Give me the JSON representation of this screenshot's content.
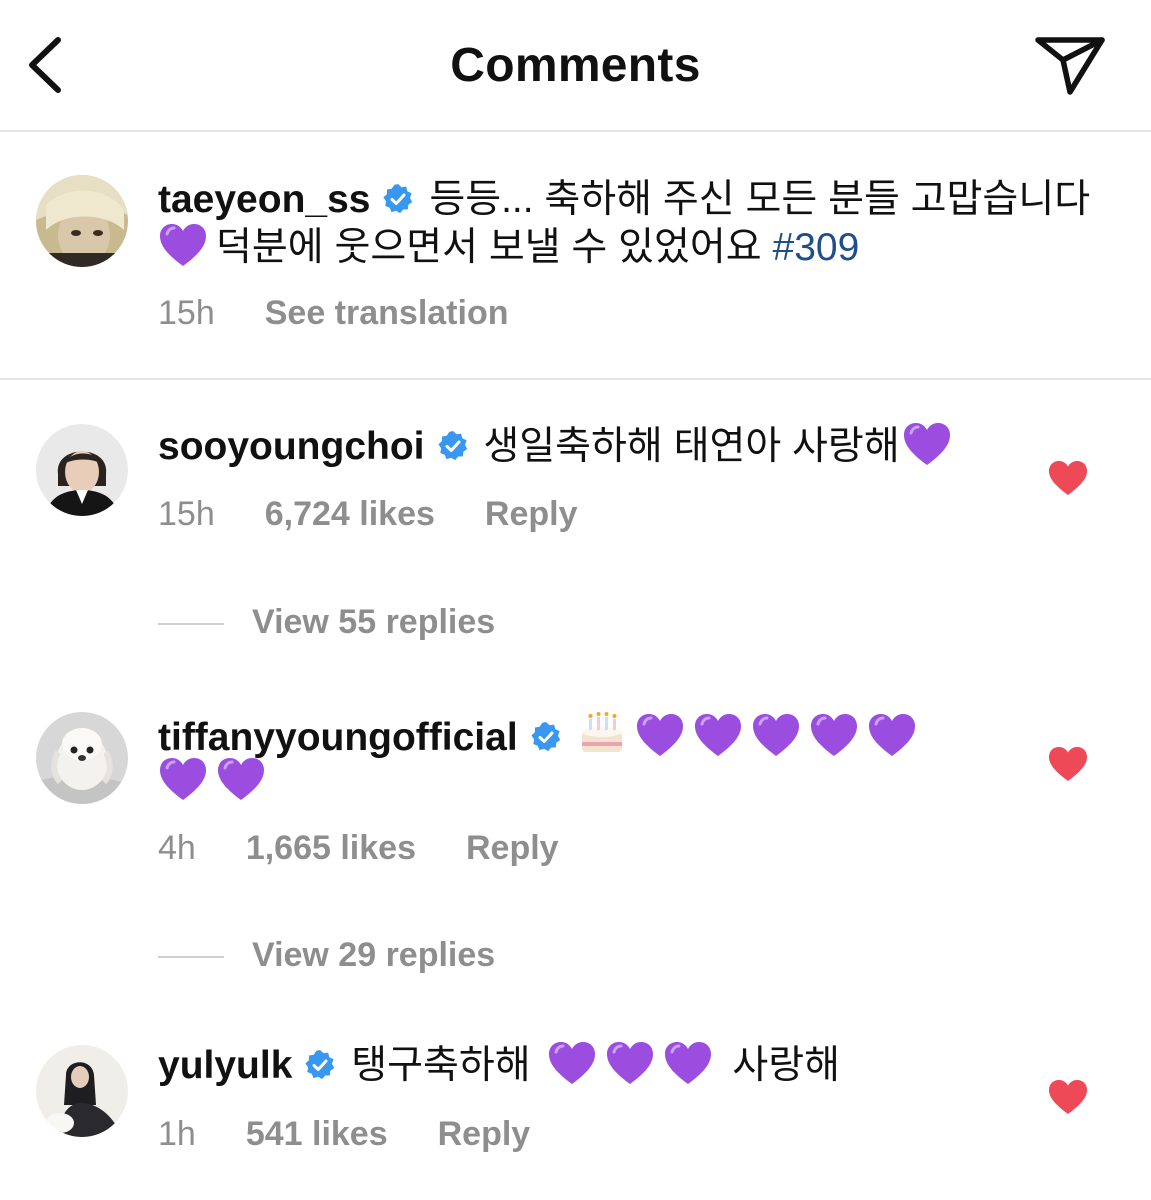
{
  "header": {
    "title": "Comments"
  },
  "caption": {
    "username": "taeyeon_ss",
    "text_part1": "등등... 축하해 주신 모든 분들 고맙습니다",
    "text_part2": "덕분에 웃으면서 보낼 수 있었어요",
    "hashtag": "#309",
    "time": "15h",
    "see_translation": "See translation"
  },
  "comments": [
    {
      "username": "sooyoungchoi",
      "text": "생일축하해 태연아 사랑해",
      "time": "15h",
      "likes": "6,724 likes",
      "reply": "Reply",
      "view_replies": "View 55 replies"
    },
    {
      "username": "tiffanyyoungofficial",
      "time": "4h",
      "likes": "1,665 likes",
      "reply": "Reply",
      "view_replies": "View 29 replies"
    },
    {
      "username": "yulyulk",
      "text_part1": "탱구축하해",
      "text_part2": "사랑해",
      "time": "1h",
      "likes": "541 likes",
      "reply": "Reply"
    }
  ],
  "colors": {
    "verified": "#3897f0",
    "purple_heart": "#9b4de0",
    "like_heart": "#ed4956",
    "hashtag": "#1f4f8a",
    "secondary_text": "#8e8e8e"
  },
  "icons": [
    "back-chevron-icon",
    "send-icon",
    "verified-badge-icon",
    "purple-heart-emoji",
    "birthday-cake-emoji",
    "like-heart-icon"
  ]
}
